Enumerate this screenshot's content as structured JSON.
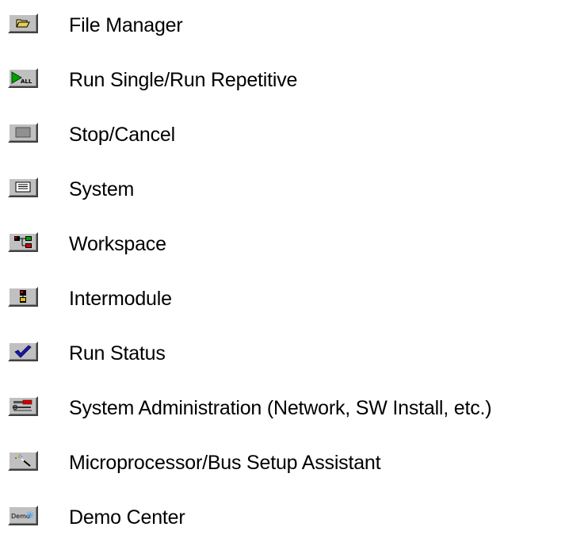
{
  "legend": {
    "items": [
      {
        "icon": "folder-open-icon",
        "label": "File Manager"
      },
      {
        "icon": "run-all-icon",
        "label": "Run Single/Run Repetitive"
      },
      {
        "icon": "stop-icon",
        "label": "Stop/Cancel"
      },
      {
        "icon": "system-icon",
        "label": "System"
      },
      {
        "icon": "workspace-icon",
        "label": "Workspace"
      },
      {
        "icon": "intermodule-icon",
        "label": "Intermodule"
      },
      {
        "icon": "checkmark-icon",
        "label": "Run Status"
      },
      {
        "icon": "tools-icon",
        "label": "System Administration (Network, SW Install, etc.)"
      },
      {
        "icon": "magic-wand-icon",
        "label": "Microprocessor/Bus Setup Assistant"
      },
      {
        "icon": "demo-icon",
        "label": "Demo Center",
        "icon_text": "Demo"
      }
    ]
  }
}
